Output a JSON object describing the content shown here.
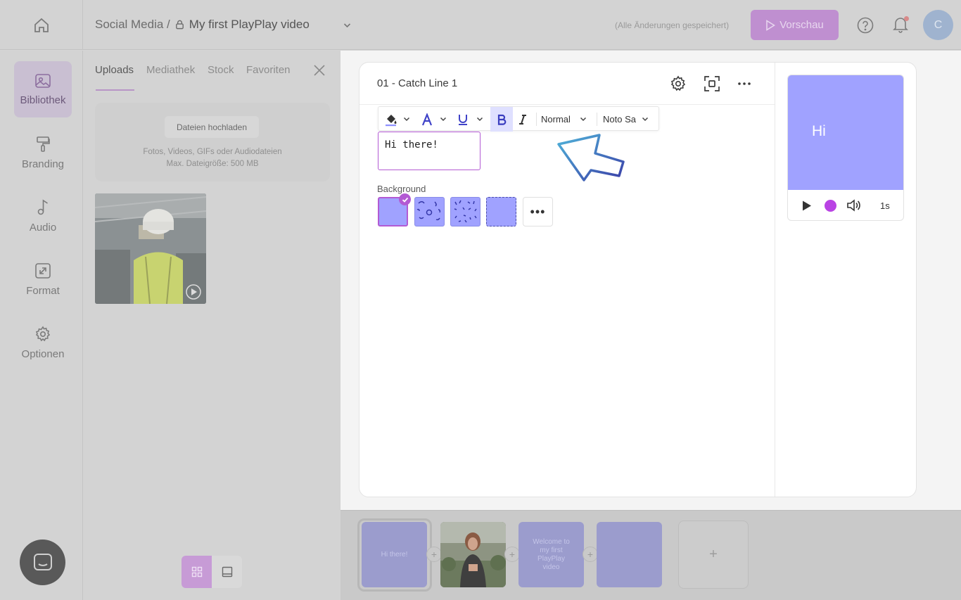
{
  "topbar": {
    "breadcrumb_parent": "Social Media /",
    "project_name": "My first PlayPlay video",
    "save_status": "(Alle Änderungen gespeichert)",
    "preview_label": "Vorschau",
    "avatar_initial": "C"
  },
  "nav": {
    "items": [
      {
        "label": "Bibliothek",
        "icon": "image-icon"
      },
      {
        "label": "Branding",
        "icon": "paint-roller-icon"
      },
      {
        "label": "Audio",
        "icon": "music-note-icon"
      },
      {
        "label": "Format",
        "icon": "resize-icon"
      },
      {
        "label": "Optionen",
        "icon": "gear-icon"
      }
    ],
    "active": "Bibliothek"
  },
  "library": {
    "tabs": [
      "Uploads",
      "Mediathek",
      "Stock",
      "Favoriten"
    ],
    "active_tab": "Uploads",
    "upload_button": "Dateien hochladen",
    "upload_hint_1": "Fotos, Videos, GIFs oder Audiodateien",
    "upload_hint_2": "Max. Dateigröße: 500 MB"
  },
  "editor": {
    "scene_title": "01 - Catch Line 1",
    "format_bar": {
      "text_style": "Normal",
      "font": "Noto Sa"
    },
    "text_value": "Hi there!",
    "background_label": "Background",
    "more_label": "•••"
  },
  "preview": {
    "text": "Hi",
    "duration": "1s"
  },
  "timeline": {
    "clips": [
      {
        "text": "Hi there!"
      },
      {
        "text": ""
      },
      {
        "text": "Welcome to my first PlayPlay video"
      },
      {
        "text": ""
      }
    ],
    "add_symbol": "+"
  },
  "colors": {
    "accent": "#b35ad3",
    "scene_background": "#a0a2ff",
    "record_dot": "#b943e4"
  }
}
